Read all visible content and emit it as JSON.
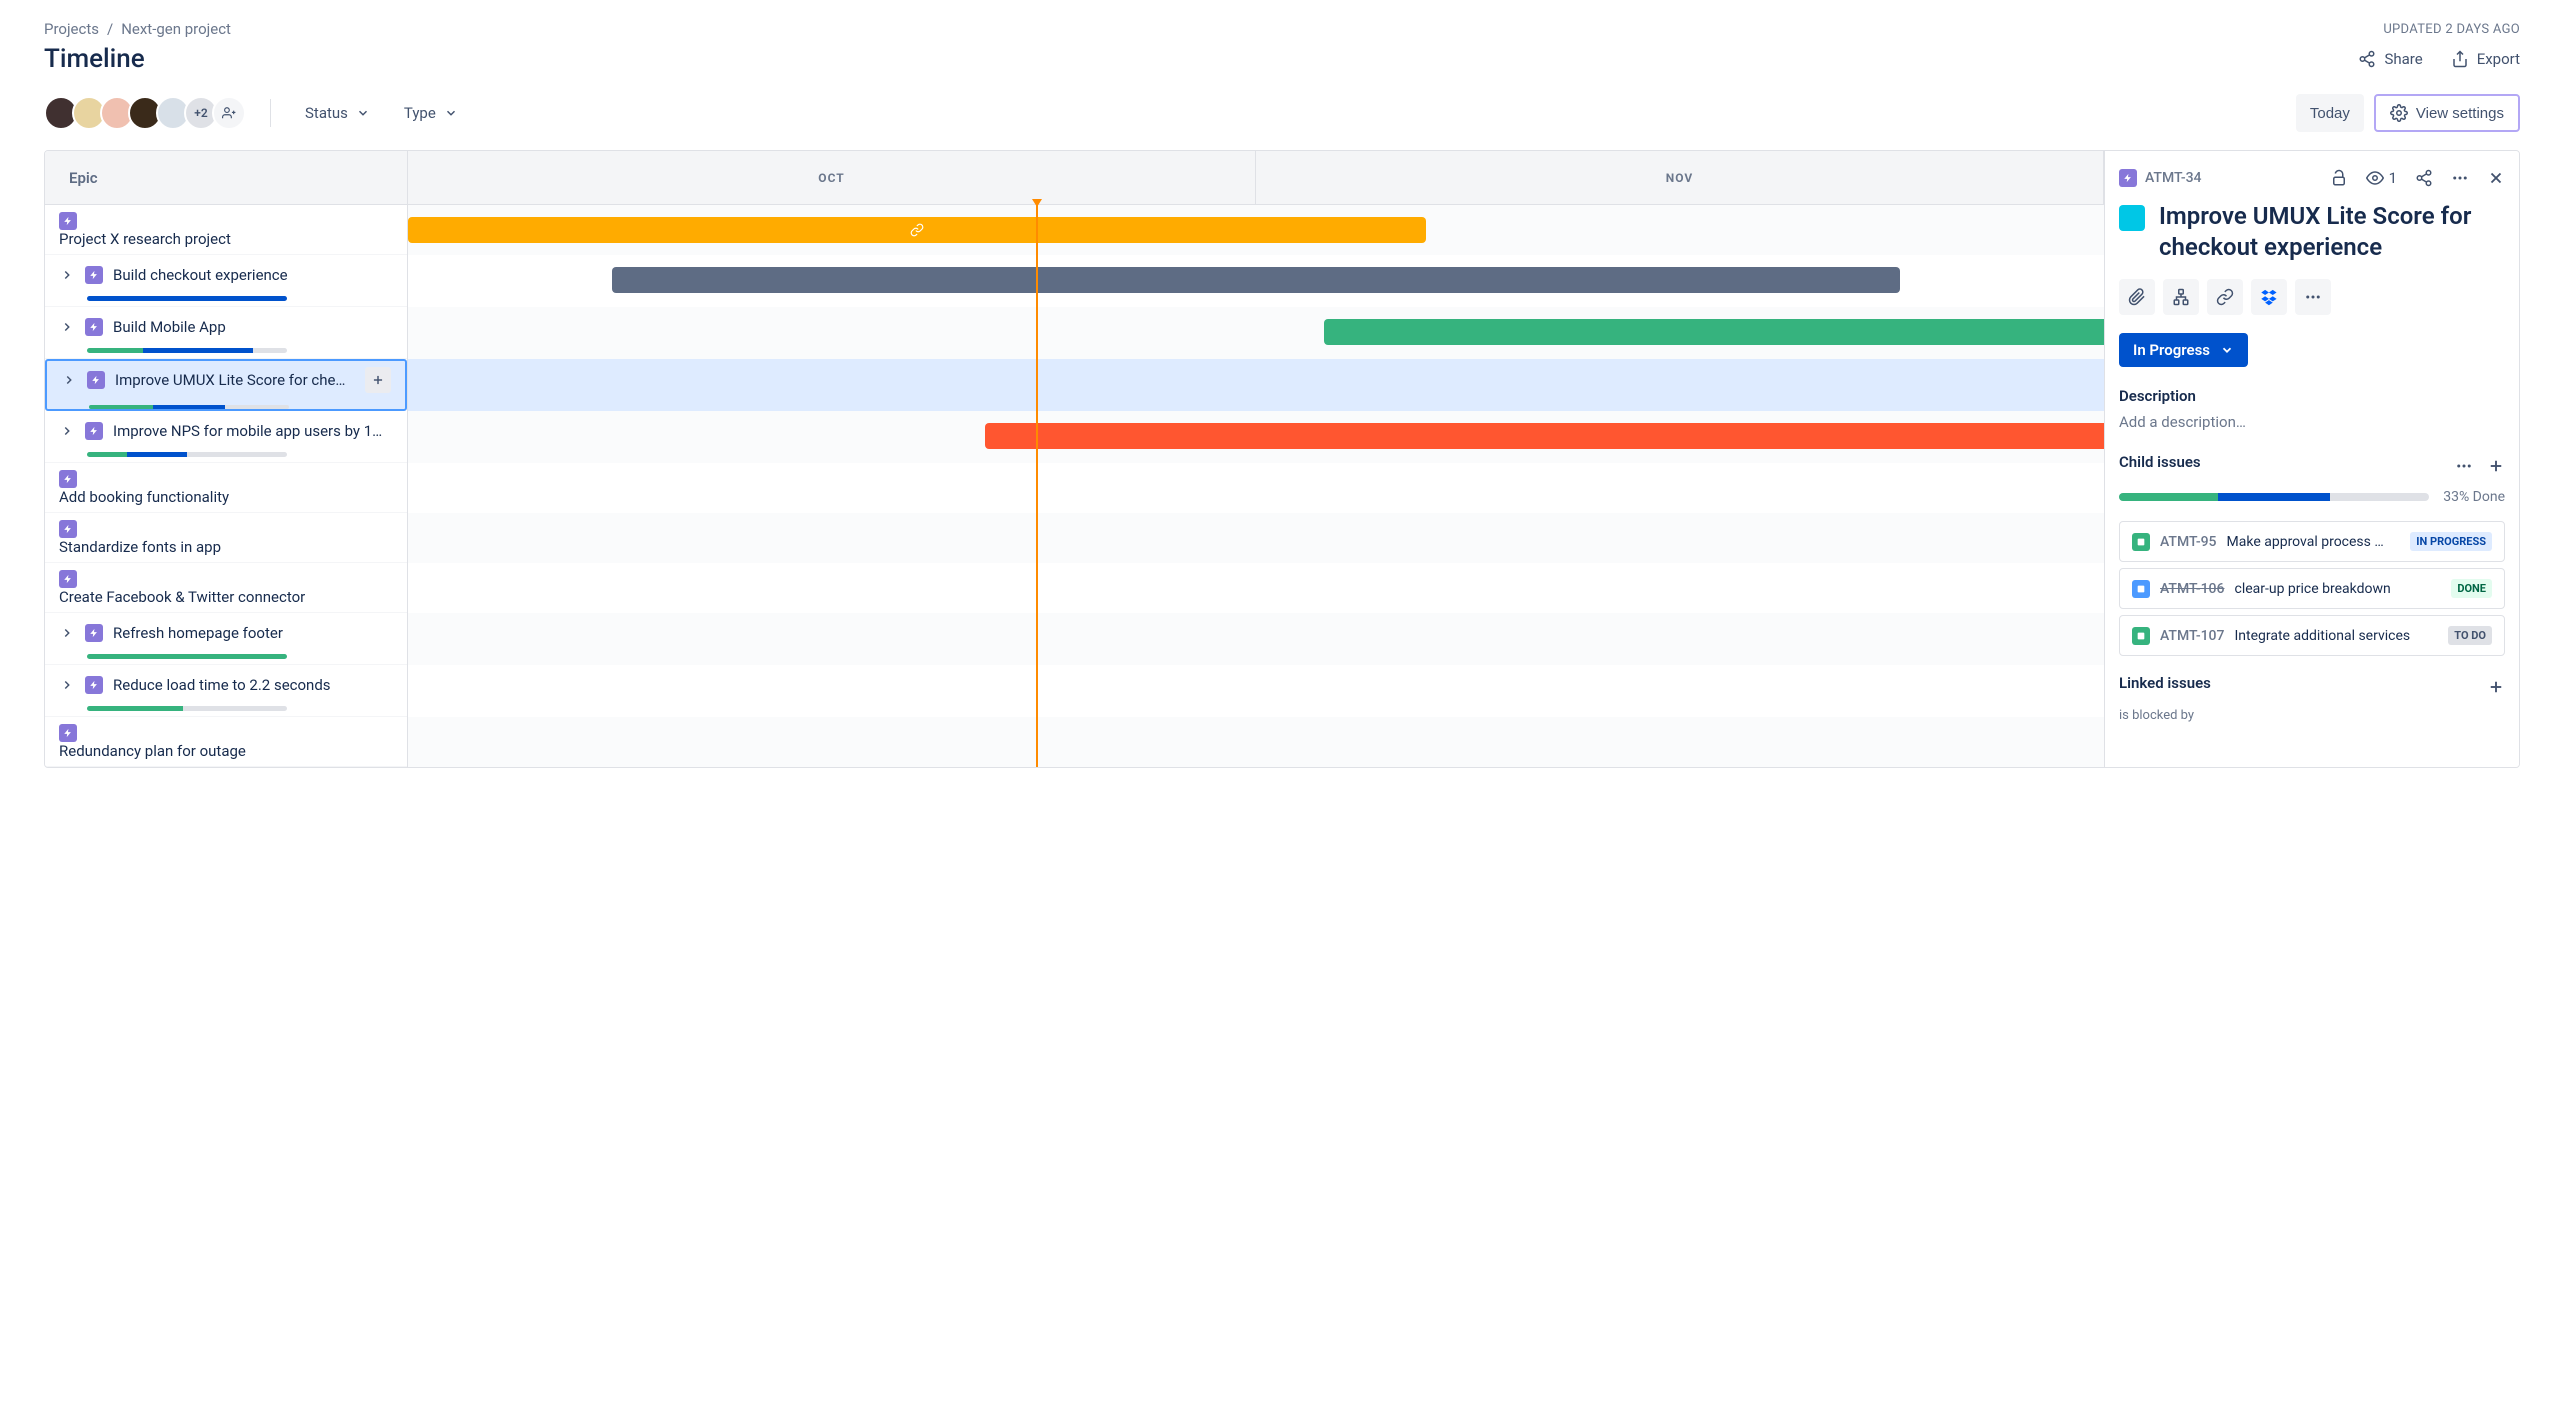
{
  "breadcrumb": {
    "projects": "Projects",
    "project_name": "Next-gen project"
  },
  "updated_text": "UPDATED 2 DAYS AGO",
  "page_title": "Timeline",
  "title_actions": {
    "share": "Share",
    "export": "Export"
  },
  "avatars": {
    "more": "+2"
  },
  "filters": {
    "status": "Status",
    "type": "Type"
  },
  "toolbar_buttons": {
    "today": "Today",
    "view_settings": "View settings"
  },
  "epic_column_header": "Epic",
  "months": [
    "OCT",
    "NOV"
  ],
  "epics": [
    {
      "title": "Project X research project",
      "expandable": false,
      "progress": null
    },
    {
      "title": "Build checkout experience",
      "expandable": true,
      "progress": {
        "blue": 100
      }
    },
    {
      "title": "Build Mobile App",
      "expandable": true,
      "progress": {
        "green": 28,
        "blue": 55,
        "grey": 17
      }
    },
    {
      "title": "Improve UMUX Lite Score for che…",
      "expandable": true,
      "selected": true,
      "progress": {
        "green": 32,
        "blue": 36,
        "grey": 32
      }
    },
    {
      "title": "Improve NPS for mobile app users by 1…",
      "expandable": true,
      "progress": {
        "green": 20,
        "blue": 30,
        "grey": 50
      }
    },
    {
      "title": "Add booking functionality",
      "expandable": false
    },
    {
      "title": "Standardize fonts in app",
      "expandable": false
    },
    {
      "title": "Create Facebook & Twitter connector",
      "expandable": false
    },
    {
      "title": "Refresh homepage footer",
      "expandable": true,
      "progress": {
        "green": 100
      }
    },
    {
      "title": "Reduce load time to 2.2 seconds",
      "expandable": true,
      "progress": {
        "green": 48,
        "grey": 52
      }
    },
    {
      "title": "Redundancy plan for outage",
      "expandable": false
    }
  ],
  "detail": {
    "issue_key": "ATMT-34",
    "watchers": "1",
    "title": "Improve UMUX Lite Score for checkout experience",
    "status": "In Progress",
    "description_label": "Description",
    "description_placeholder": "Add a description…",
    "child_issues_label": "Child issues",
    "progress_pct": "33% Done",
    "progress": {
      "green": 32,
      "blue": 36
    },
    "children": [
      {
        "key": "ATMT-95",
        "summary": "Make approval process …",
        "status": "IN PROGRESS",
        "status_class": "st-prog",
        "icon": "ci-green",
        "strike": false
      },
      {
        "key": "ATMT-106",
        "summary": "clear-up price breakdown",
        "status": "DONE",
        "status_class": "st-done",
        "icon": "ci-blue",
        "strike": true
      },
      {
        "key": "ATMT-107",
        "summary": "Integrate additional services",
        "status": "TO DO",
        "status_class": "st-todo",
        "icon": "ci-green",
        "strike": false
      }
    ],
    "linked_label": "Linked issues",
    "linked_relation": "is blocked by"
  }
}
